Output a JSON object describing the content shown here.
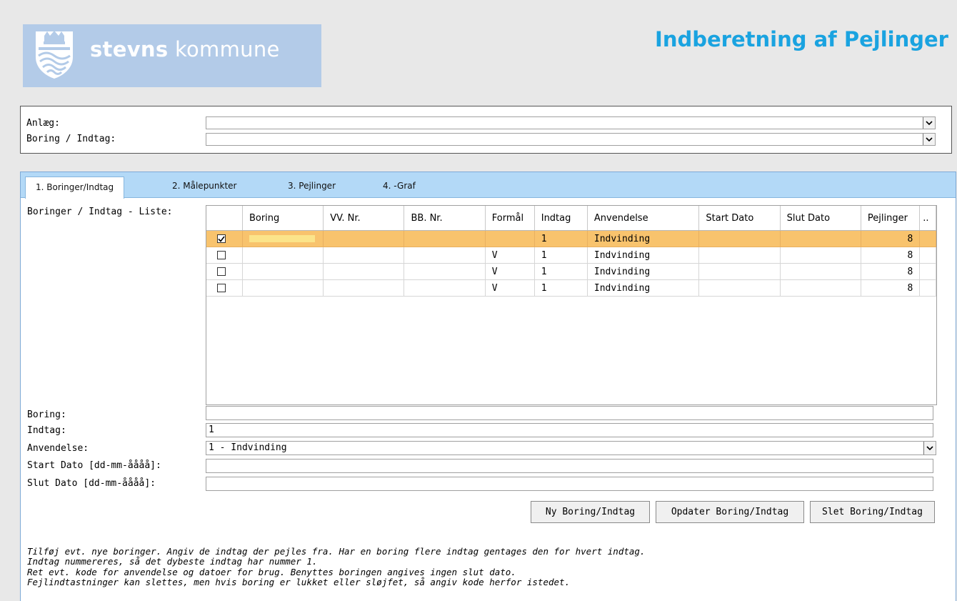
{
  "header": {
    "logo_bold": "stevns",
    "logo_rest": "kommune",
    "title": "Indberetning af Pejlinger"
  },
  "selectors": {
    "anlaeg_label": "Anlæg:",
    "anlaeg_value": "",
    "boring_indtag_label": "Boring / Indtag:",
    "boring_indtag_value": ""
  },
  "tabs": [
    {
      "label": "1. Boringer/Indtag",
      "active": true
    },
    {
      "label": "2. Målepunkter",
      "active": false
    },
    {
      "label": "3. Pejlinger",
      "active": false
    },
    {
      "label": "4. -Graf",
      "active": false
    }
  ],
  "list": {
    "label": "Boringer / Indtag - Liste:",
    "columns": [
      "",
      "Boring",
      "VV. Nr.",
      "BB. Nr.",
      "Formål",
      "Indtag",
      "Anvendelse",
      "Start Dato",
      "Slut Dato",
      "Pejlinger",
      ".."
    ],
    "rows": [
      {
        "checked": true,
        "selected": true,
        "boring": "",
        "vv_nr": "",
        "bb_nr": "",
        "formaal": "",
        "indtag": "1",
        "anvendelse": "Indvinding",
        "start": "",
        "slut": "",
        "pejlinger": "8"
      },
      {
        "checked": false,
        "selected": false,
        "boring": "",
        "vv_nr": "",
        "bb_nr": "",
        "formaal": "V",
        "indtag": "1",
        "anvendelse": "Indvinding",
        "start": "",
        "slut": "",
        "pejlinger": "8"
      },
      {
        "checked": false,
        "selected": false,
        "boring": "",
        "vv_nr": "",
        "bb_nr": "",
        "formaal": "V",
        "indtag": "1",
        "anvendelse": "Indvinding",
        "start": "",
        "slut": "",
        "pejlinger": "8"
      },
      {
        "checked": false,
        "selected": false,
        "boring": "",
        "vv_nr": "",
        "bb_nr": "",
        "formaal": "V",
        "indtag": "1",
        "anvendelse": "Indvinding",
        "start": "",
        "slut": "",
        "pejlinger": "8"
      }
    ]
  },
  "form": {
    "boring_label": "Boring:",
    "boring_value": "",
    "indtag_label": "Indtag:",
    "indtag_value": "1",
    "anvendelse_label": "Anvendelse:",
    "anvendelse_value": "1 - Indvinding",
    "start_label": "Start Dato [dd-mm-åååå]:",
    "start_value": "",
    "slut_label": "Slut Dato [dd-mm-åååå]:",
    "slut_value": ""
  },
  "buttons": {
    "new": "Ny Boring/Indtag",
    "update": "Opdater Boring/Indtag",
    "delete": "Slet Boring/Indtag"
  },
  "help": {
    "line1": "Tilføj evt. nye boringer. Angiv de indtag der pejles fra. Har en boring flere indtag gentages den for hvert indtag.",
    "line2": "Indtag nummereres, så det dybeste indtag har nummer 1.",
    "line3": "Ret evt. kode for anvendelse og datoer for brug. Benyttes boringen angives ingen slut dato.",
    "line4": "Fejlindtastninger kan slettes, men hvis boring er lukket eller sløjfet, så angiv kode herfor istedet."
  },
  "colors": {
    "title_blue": "#1aa3e0",
    "logo_bg": "#b3cbe8",
    "tabbar_bg": "#b3d9f7",
    "selected_row": "#f8c36d"
  }
}
